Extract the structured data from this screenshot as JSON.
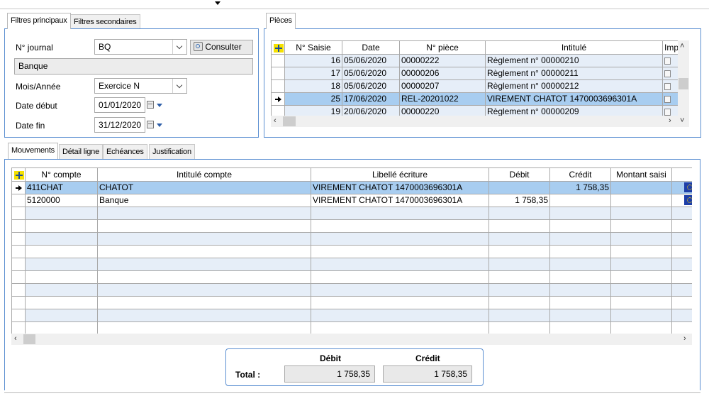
{
  "filters": {
    "tabs": [
      "Filtres principaux",
      "Filtres secondaires"
    ],
    "journal_label": "N° journal",
    "journal_value": "BQ",
    "consult_button": "Consulter",
    "journal_name": "Banque",
    "month_year_label": "Mois/Année",
    "month_year_value": "Exercice N",
    "start_label": "Date début",
    "start_value": "01/01/2020",
    "end_label": "Date fin",
    "end_value": "31/12/2020"
  },
  "pieces": {
    "tab": "Pièces",
    "columns": [
      "N° Saisie",
      "Date",
      "N° pièce",
      "Intitulé",
      "Imp"
    ],
    "rows": [
      {
        "saisie": "16",
        "date": "05/06/2020",
        "piece": "00000222",
        "intitule": "Règlement n° 00000210",
        "selected": false
      },
      {
        "saisie": "17",
        "date": "05/06/2020",
        "piece": "00000206",
        "intitule": "Règlement n° 00000211",
        "selected": false
      },
      {
        "saisie": "18",
        "date": "05/06/2020",
        "piece": "00000207",
        "intitule": "Règlement n° 00000212",
        "selected": false
      },
      {
        "saisie": "25",
        "date": "17/06/2020",
        "piece": "REL-20201022",
        "intitule": "VIREMENT CHATOT 1470003696301A",
        "selected": true
      },
      {
        "saisie": "19",
        "date": "20/06/2020",
        "piece": "00000220",
        "intitule": "Règlement n° 00000209",
        "selected": false
      }
    ]
  },
  "movements": {
    "tabs": [
      "Mouvements",
      "Détail ligne",
      "Echéances",
      "Justification"
    ],
    "columns": [
      "N° compte",
      "Intitulé compte",
      "Libellé écriture",
      "Débit",
      "Crédit",
      "Montant saisi"
    ],
    "rows": [
      {
        "compte": "411CHAT",
        "intitule": "CHATOT",
        "libelle": "VIREMENT CHATOT 1470003696301A",
        "debit": "",
        "credit": "1 758,35",
        "selected": true
      },
      {
        "compte": "5120000",
        "intitule": "Banque",
        "libelle": "VIREMENT CHATOT 1470003696301A",
        "debit": "1 758,35",
        "credit": "",
        "selected": false
      }
    ]
  },
  "totals": {
    "debit_label": "Débit",
    "credit_label": "Crédit",
    "total_label": "Total :",
    "debit_value": "1 758,35",
    "credit_value": "1 758,35"
  },
  "icons": {
    "add_row": "add-row-icon",
    "current_row": "current-row-arrow-icon",
    "calendar": "calendar-icon",
    "consult": "consult-icon",
    "currency": "currency-flag-icon"
  }
}
